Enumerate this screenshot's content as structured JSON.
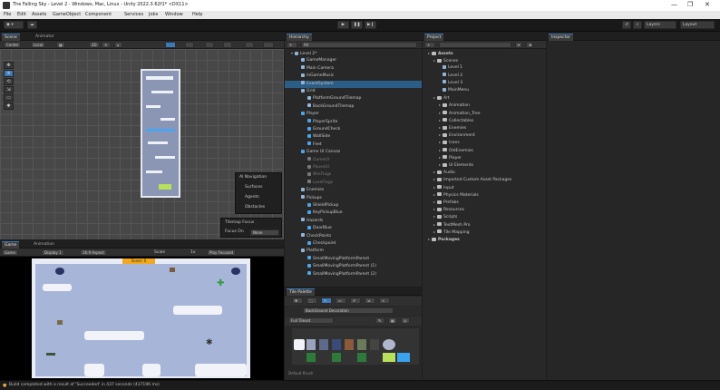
{
  "window": {
    "title": "The Falling Sky - Level 2 - Windows, Mac, Linux - Unity 2022.3.62f1* <DX11>",
    "controls": [
      "—",
      "❐",
      "✕"
    ]
  },
  "menu": [
    "File",
    "Edit",
    "Assets",
    "GameObject",
    "Component",
    "Services",
    "Jobs",
    "Window",
    "Help"
  ],
  "toolbar": {
    "account_label": "◉ ▾",
    "cloud_label": "☁",
    "play_icons": [
      "▶",
      "❚❚",
      "▶❙"
    ],
    "history_icon": "↺",
    "search_icon": "⌕",
    "layers_label": "Layers",
    "layout_label": "Layout"
  },
  "scene_panel": {
    "tabs": [
      "Scene",
      "Animator"
    ],
    "sub_buttons": [
      "Center",
      "Local",
      "▦",
      "2D",
      "☀",
      "⌂"
    ],
    "tools": [
      "✥",
      "⊕",
      "⟲",
      "⇲",
      "▭",
      "✱"
    ],
    "overlay_ai": {
      "title": "AI Navigation",
      "items": [
        "Surfaces",
        "Agents",
        "Obstacles"
      ]
    },
    "overlay_tilemap": {
      "title": "Tilemap Focus",
      "label": "Focus On",
      "value": "None"
    }
  },
  "game_panel": {
    "tabs": [
      "Game",
      "Animation"
    ],
    "display_label": "Display 1",
    "aspect_label": "16:9 Aspect",
    "scale_label": "Scale",
    "scale_value": "1x",
    "play_focused": "Play Focused",
    "score_label": "Score: 0"
  },
  "hierarchy": {
    "tab": "Hierarchy",
    "search_placeholder": "All",
    "rows": [
      {
        "label": "Level 2*",
        "indent": 1,
        "kind": "scene"
      },
      {
        "label": "GameManager",
        "indent": 2,
        "kind": "cube"
      },
      {
        "label": "Main Camera",
        "indent": 2,
        "kind": "cube"
      },
      {
        "label": "InGameMusic",
        "indent": 2,
        "kind": "cube"
      },
      {
        "label": "EventSystem",
        "indent": 2,
        "kind": "cube",
        "selected": true
      },
      {
        "label": "Grid",
        "indent": 2,
        "kind": "cube"
      },
      {
        "label": "PlatformGroundTilemap",
        "indent": 3,
        "kind": "cube"
      },
      {
        "label": "BackGroundTilemap",
        "indent": 3,
        "kind": "cube"
      },
      {
        "label": "Player",
        "indent": 2,
        "kind": "blue"
      },
      {
        "label": "PlayerSprite",
        "indent": 3,
        "kind": "blue"
      },
      {
        "label": "GroundCheck",
        "indent": 3,
        "kind": "blue"
      },
      {
        "label": "WallSide",
        "indent": 3,
        "kind": "blue"
      },
      {
        "label": "Feet",
        "indent": 3,
        "kind": "blue"
      },
      {
        "label": "Game UI Canvas",
        "indent": 2,
        "kind": "blue"
      },
      {
        "label": "GameUI",
        "indent": 3,
        "kind": "gray"
      },
      {
        "label": "PauseUI",
        "indent": 3,
        "kind": "gray"
      },
      {
        "label": "WinFlags",
        "indent": 3,
        "kind": "gray"
      },
      {
        "label": "LoseFlags",
        "indent": 3,
        "kind": "gray"
      },
      {
        "label": "Enemies",
        "indent": 2,
        "kind": "cube"
      },
      {
        "label": "Pickups",
        "indent": 2,
        "kind": "cube"
      },
      {
        "label": "ShieldPickup",
        "indent": 3,
        "kind": "blue"
      },
      {
        "label": "KeyPickupBlue",
        "indent": 3,
        "kind": "blue"
      },
      {
        "label": "Hazards",
        "indent": 2,
        "kind": "cube"
      },
      {
        "label": "DoorBlue",
        "indent": 3,
        "kind": "blue"
      },
      {
        "label": "CheckPoints",
        "indent": 2,
        "kind": "cube"
      },
      {
        "label": "Checkpoint",
        "indent": 3,
        "kind": "blue"
      },
      {
        "label": "Platform",
        "indent": 2,
        "kind": "cube"
      },
      {
        "label": "SmallMovingPlatformParent",
        "indent": 3,
        "kind": "blue"
      },
      {
        "label": "SmallMovingPlatformParent (1)",
        "indent": 3,
        "kind": "blue"
      },
      {
        "label": "SmallMovingPlatformParent (2)",
        "indent": 3,
        "kind": "blue"
      }
    ]
  },
  "tile_palette": {
    "tab": "Tile Palette",
    "tools": [
      "✥",
      "⬚",
      "✎",
      "▭",
      "✐",
      "⇲",
      "⨯"
    ],
    "active_tilemap": "BackGround Decoration",
    "palette": "Full Tileset",
    "footer": "Default Brush"
  },
  "project": {
    "tab": "Project",
    "rows": [
      {
        "label": "Assets",
        "indent": 1,
        "bold": true
      },
      {
        "label": "Scenes",
        "indent": 2
      },
      {
        "label": "Level 1",
        "indent": 3,
        "scene": true
      },
      {
        "label": "Level 2",
        "indent": 3,
        "scene": true
      },
      {
        "label": "Level 3",
        "indent": 3,
        "scene": true
      },
      {
        "label": "MainMenu",
        "indent": 3,
        "scene": true
      },
      {
        "label": "Art",
        "indent": 2
      },
      {
        "label": "Animation",
        "indent": 3
      },
      {
        "label": "Animation_Tree",
        "indent": 3
      },
      {
        "label": "Collectables",
        "indent": 3
      },
      {
        "label": "Enemies",
        "indent": 3
      },
      {
        "label": "Environment",
        "indent": 3
      },
      {
        "label": "Icons",
        "indent": 3
      },
      {
        "label": "OldEnemies",
        "indent": 3
      },
      {
        "label": "Player",
        "indent": 3
      },
      {
        "label": "UI Elements",
        "indent": 3
      },
      {
        "label": "Audio",
        "indent": 2
      },
      {
        "label": "Imported Custom Asset Packages",
        "indent": 2
      },
      {
        "label": "Input",
        "indent": 2
      },
      {
        "label": "Physics Materials",
        "indent": 2
      },
      {
        "label": "Prefabs",
        "indent": 2
      },
      {
        "label": "Resources",
        "indent": 2
      },
      {
        "label": "Scripts",
        "indent": 2
      },
      {
        "label": "TextMesh Pro",
        "indent": 2
      },
      {
        "label": "Tile Mapping",
        "indent": 2
      },
      {
        "label": "Packages",
        "indent": 1,
        "bold": true
      }
    ]
  },
  "inspector": {
    "tab": "Inspector"
  },
  "status": {
    "message": "Build completed with a result of 'Succeeded' in 437 seconds (437196 ms)"
  },
  "colors": {
    "accent": "#3a79bb",
    "selection": "#2c5d87",
    "game_bg": "#a7b6d8",
    "game_wall": "#e8ecf4"
  }
}
